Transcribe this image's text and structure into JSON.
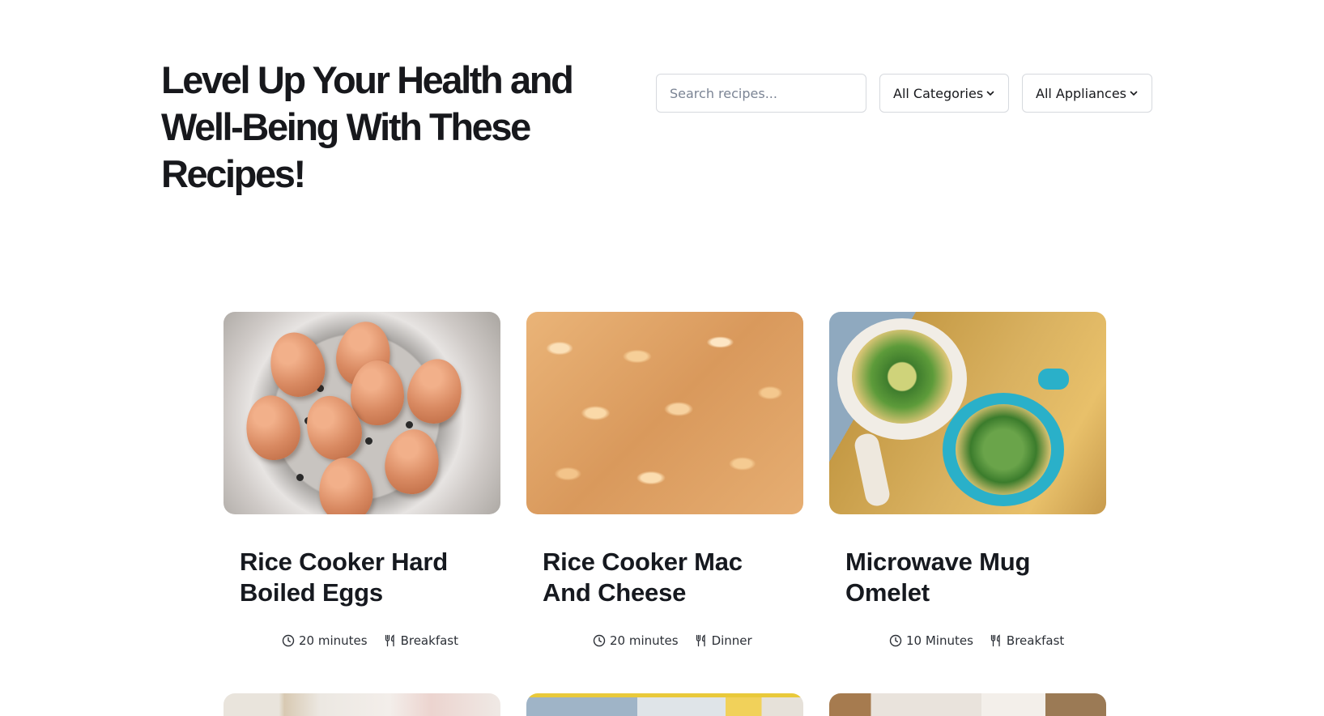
{
  "header": {
    "title": "Level Up Your Health and Well-Being With These Recipes!"
  },
  "filters": {
    "search_placeholder": "Search recipes...",
    "category_selected": "All Categories",
    "appliance_selected": "All Appliances"
  },
  "recipes": [
    {
      "title": "Rice Cooker Hard Boiled Eggs",
      "time": "20 minutes",
      "category": "Breakfast",
      "image": "eggs-in-steamer-basket"
    },
    {
      "title": "Rice Cooker Mac And Cheese",
      "time": "20 minutes",
      "category": "Dinner",
      "image": "macaroni-and-cheese"
    },
    {
      "title": "Microwave Mug Omelet",
      "time": "10 Minutes",
      "category": "Breakfast",
      "image": "omelets-in-mugs"
    }
  ],
  "icons": {
    "time": "clock-icon",
    "category": "fork-knife-icon",
    "dropdown": "chevron-down-icon"
  }
}
